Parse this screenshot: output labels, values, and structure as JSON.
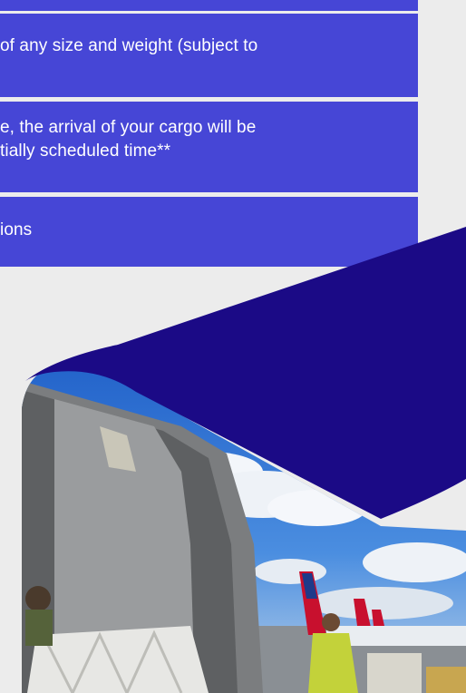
{
  "benefits": {
    "items": [
      {
        "line1": " of any size and weight (subject to",
        "line2": ""
      },
      {
        "line1": "e, the arrival of your cargo will be",
        "line2": "tially scheduled time**"
      },
      {
        "line1": "ions",
        "line2": ""
      }
    ]
  },
  "colors": {
    "page_bg": "#ececec",
    "row_bg": "#4646d6",
    "shape_navy": "#1b0a86",
    "sky": "#2f6fd0"
  },
  "hero": {
    "image_icon": "cargo-loading-photo",
    "shape_icon": "navy-wedge-shape"
  }
}
